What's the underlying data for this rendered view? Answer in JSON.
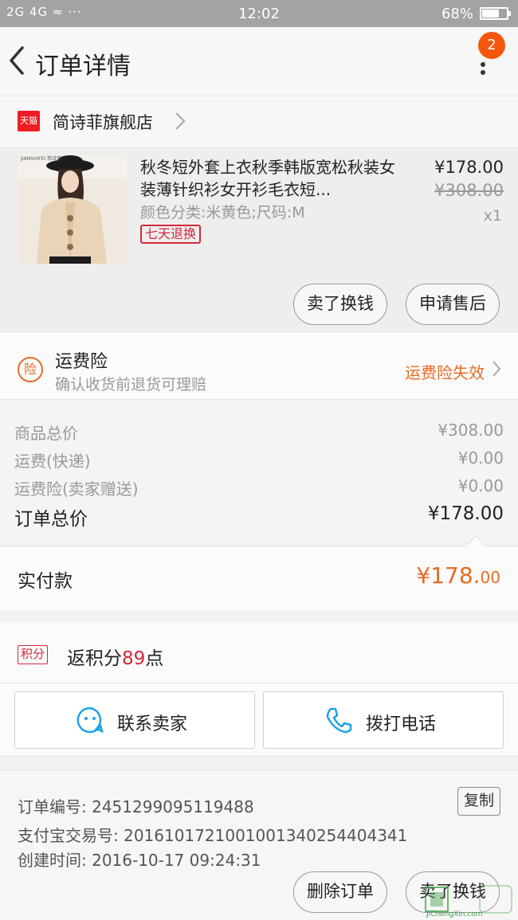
{
  "status_bar": {
    "signal": "2G 4G",
    "time": "12:02",
    "battery": "68%",
    "battery_level": 0.68
  },
  "header": {
    "title": "订单详情",
    "badge_count": "2"
  },
  "shop": {
    "logo_text": "天猫",
    "name": "简诗菲旗舰店"
  },
  "product": {
    "brand_text": "JIANSHIFEI 简诗菲",
    "title": "秋冬短外套上衣秋季韩版宽松秋装女装薄针织衫女开衫毛衣短...",
    "spec": "颜色分类:米黄色;尺码:M",
    "tag": "七天退换",
    "price": "¥178.00",
    "original_price": "¥308.00",
    "quantity": "x1",
    "sell_button": "卖了换钱",
    "aftersale_button": "申请售后"
  },
  "insurance": {
    "icon_text": "险",
    "title": "运费险",
    "subtitle": "确认收货前退货可理赔",
    "status": "运费险失效"
  },
  "summary": {
    "rows": [
      {
        "label": "商品总价",
        "value": "¥308.00"
      },
      {
        "label": "运费(快递)",
        "value": "¥0.00"
      },
      {
        "label": "运费险(卖家赠送)",
        "value": "¥0.00"
      }
    ],
    "total_label": "订单总价",
    "total_value": "¥178.00"
  },
  "paid": {
    "label": "实付款",
    "value_main": "¥178.",
    "value_cents": "00"
  },
  "points": {
    "tag": "积分",
    "prefix": "返积分",
    "number": "89",
    "suffix": "点"
  },
  "contact": {
    "seller_label": "联系卖家",
    "phone_label": "拨打电话"
  },
  "order_info": {
    "order_no": "订单编号: 2451299095119488",
    "alipay_no": "支付宝交易号: 2016101721001001340254404341",
    "created": "创建时间: 2016-10-17 09:24:31",
    "copy_label": "复制"
  },
  "footer": {
    "delete_button": "删除订单",
    "sell_button": "卖了换钱"
  },
  "watermark": {
    "text": "JiChengXin.com"
  },
  "colors": {
    "accent_orange": "#e86a25",
    "tmall_red": "#ee1d23",
    "tag_red": "#d4283b",
    "badge_orange": "#f5560d",
    "icon_blue": "#1ba2e6"
  }
}
